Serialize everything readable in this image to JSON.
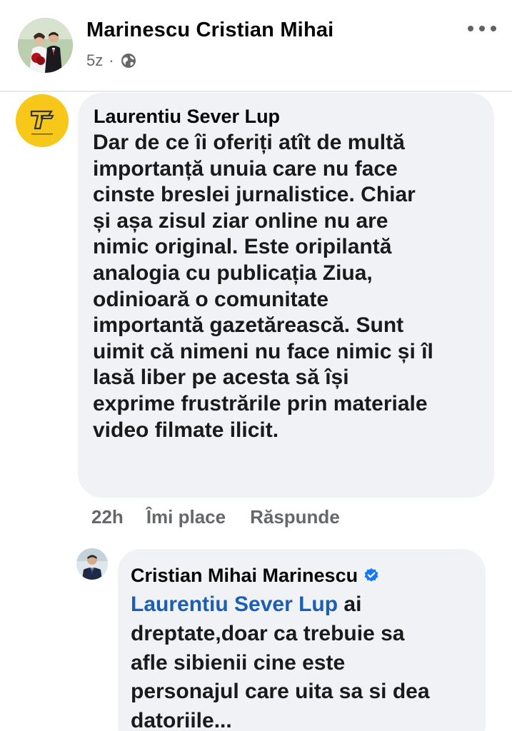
{
  "post": {
    "author": "Marinescu Cristian Mihai",
    "time": "5z",
    "separator": "·",
    "privacy_icon": "globe-icon",
    "more_icon": "more-options-icon"
  },
  "comments": [
    {
      "author": "Laurentiu Sever Lup",
      "avatar_icon": "yellow-logo-avatar",
      "text": "Dar de ce îi oferiți atît de multă\nimportanță unuia care nu face\ncinste breslei jurnalistice. Chiar\nși așa zisul ziar online nu are\nnimic original. Este oripilantă\nanalogia cu publicația Ziua,\nodinioară o comunitate\nimportantă gazetărească. Sunt\nuimit că nimeni nu face nimic și îl\nlasă liber pe acesta să își\nexprime frustrările prin materiale\nvideo filmate ilicit.",
      "time": "22h",
      "like_label": "Îmi place",
      "reply_label": "Răspunde"
    },
    {
      "author": "Cristian Mihai Marinescu",
      "verified_icon": "verified-badge-icon",
      "mention": "Laurentiu Sever Lup",
      "text_after_mention": " ai\ndreptate,doar ca trebuie sa\nafle sibienii cine este\npersonajul care uita sa si dea\ndatoriile..."
    }
  ],
  "colors": {
    "background": "#ffffff",
    "bubble": "#f0f2f5",
    "secondary_text": "#65676b",
    "mention_blue": "#1a5fb4",
    "verified_blue": "#1877f2",
    "logo_yellow": "#f7c71a"
  }
}
